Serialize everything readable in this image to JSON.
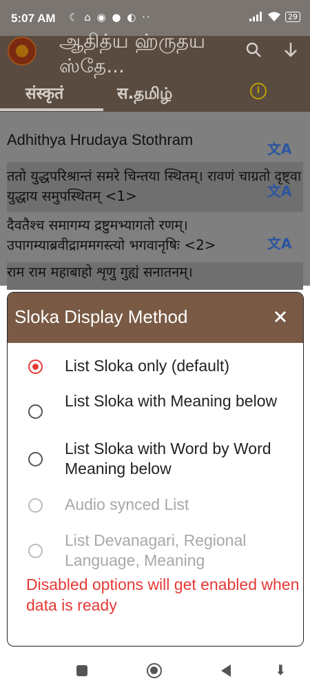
{
  "status_bar": {
    "time": "5:07 AM",
    "left_icons": "☾ ⌂ ◉ ● ◐  ··",
    "battery": "29"
  },
  "app_bar": {
    "title": "ஆதித்ய ஹ்ருதய ஸ்தே...",
    "tabs": [
      {
        "label": "संस्कृतं"
      },
      {
        "label": "स.தமிழ்"
      }
    ],
    "info": "i"
  },
  "content": {
    "rows": [
      "Adhithya Hrudaya Stothram",
      "ततो युद्धपरिश्रान्तं समरे चिन्तया स्थितम्। रावणं चाग्रतो दृष्ट्वा युद्धाय समुपस्थितम् <1>",
      "दैवतैश्च समागम्य द्रष्टुमभ्यागतो रणम्। उपागम्याब्रवीद्राममगस्त्यो भगवानृषिः <2>",
      "राम राम महाबाहो शृणु गुह्यं सनातनम्।"
    ],
    "translate_icon": "文A"
  },
  "dialog": {
    "title": "Sloka Display Method",
    "options": [
      {
        "label": "List Sloka only (default)",
        "selected": true,
        "disabled": false
      },
      {
        "label": "List Sloka with Meaning below",
        "selected": false,
        "disabled": false
      },
      {
        "label": "List Sloka with Word by Word Meaning below",
        "selected": false,
        "disabled": false
      },
      {
        "label": "Audio synced List",
        "selected": false,
        "disabled": true
      },
      {
        "label": "List Devanagari, Regional Language, Meaning",
        "selected": false,
        "disabled": true
      }
    ],
    "notice": "Disabled options will get enabled when data is ready"
  },
  "colors": {
    "header_brown": "#7a5a45",
    "accent_red": "#e53935",
    "disabled_gray": "#a8a8a8",
    "translate_blue": "#2a55a0"
  }
}
